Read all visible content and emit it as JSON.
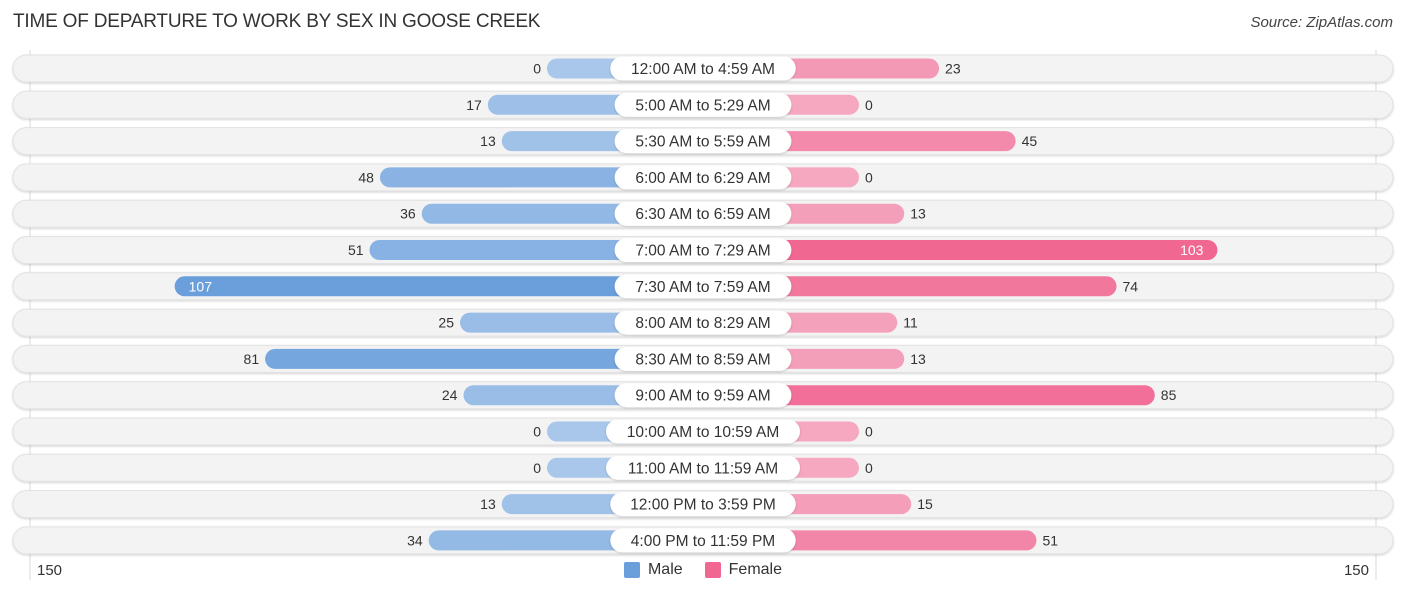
{
  "header": {
    "title": "TIME OF DEPARTURE TO WORK BY SEX IN GOOSE CREEK",
    "source": "Source: ZipAtlas.com"
  },
  "colors": {
    "male": "#6a9fdc",
    "male_light": "#a9c7ea",
    "female": "#f06792",
    "female_light": "#f5a8c0",
    "row_bg": "#f3f3f3"
  },
  "legend": {
    "male_label": "Male",
    "female_label": "Female"
  },
  "axis": {
    "left_label": "150",
    "right_label": "150"
  },
  "chart_data": {
    "type": "bar",
    "orientation": "horizontal-diverging",
    "title": "TIME OF DEPARTURE TO WORK BY SEX IN GOOSE CREEK",
    "xlabel": "",
    "ylabel": "",
    "xlim": [
      -150,
      150
    ],
    "legend_position": "bottom-center",
    "categories": [
      "12:00 AM to 4:59 AM",
      "5:00 AM to 5:29 AM",
      "5:30 AM to 5:59 AM",
      "6:00 AM to 6:29 AM",
      "6:30 AM to 6:59 AM",
      "7:00 AM to 7:29 AM",
      "7:30 AM to 7:59 AM",
      "8:00 AM to 8:29 AM",
      "8:30 AM to 8:59 AM",
      "9:00 AM to 9:59 AM",
      "10:00 AM to 10:59 AM",
      "11:00 AM to 11:59 AM",
      "12:00 PM to 3:59 PM",
      "4:00 PM to 11:59 PM"
    ],
    "series": [
      {
        "name": "Male",
        "values": [
          0,
          17,
          13,
          48,
          36,
          51,
          107,
          25,
          81,
          24,
          0,
          0,
          13,
          34
        ]
      },
      {
        "name": "Female",
        "values": [
          23,
          0,
          45,
          0,
          13,
          103,
          74,
          11,
          13,
          85,
          0,
          0,
          15,
          51
        ]
      }
    ]
  }
}
